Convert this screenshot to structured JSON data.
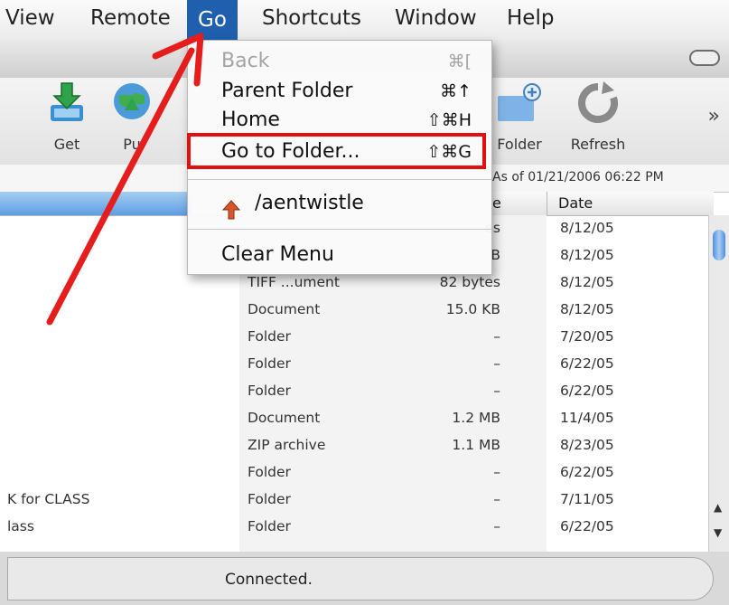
{
  "menubar": {
    "items": [
      "View",
      "Remote",
      "Go",
      "Shortcuts",
      "Window",
      "Help"
    ],
    "active": "Go"
  },
  "toolbar": {
    "buttons": [
      "Get",
      "Pu",
      "Folder",
      "Refresh"
    ],
    "overflow": "»"
  },
  "status_line": "As of 01/21/2006 06:22 PM",
  "columns": {
    "size": "e",
    "date": "Date"
  },
  "rows": [
    {
      "name": "",
      "kind": "",
      "size": "es",
      "date": "8/12/05"
    },
    {
      "name": "",
      "kind": "",
      "size": "B",
      "date": "8/12/05"
    },
    {
      "name": "",
      "kind": "TIFF ...ument",
      "size": "82 bytes",
      "date": "8/12/05"
    },
    {
      "name": "",
      "kind": "Document",
      "size": "15.0 KB",
      "date": "8/12/05"
    },
    {
      "name": "",
      "kind": "Folder",
      "size": "–",
      "date": "7/20/05"
    },
    {
      "name": "",
      "kind": "Folder",
      "size": "–",
      "date": "6/22/05"
    },
    {
      "name": "",
      "kind": "Folder",
      "size": "–",
      "date": "6/22/05"
    },
    {
      "name": "",
      "kind": "Document",
      "size": "1.2 MB",
      "date": "11/4/05"
    },
    {
      "name": "",
      "kind": "ZIP archive",
      "size": "1.1 MB",
      "date": "8/23/05"
    },
    {
      "name": "",
      "kind": "Folder",
      "size": "–",
      "date": "6/22/05"
    },
    {
      "name": "K for CLASS",
      "kind": "Folder",
      "size": "–",
      "date": "7/11/05"
    },
    {
      "name": "lass",
      "kind": "Folder",
      "size": "–",
      "date": "6/22/05"
    }
  ],
  "go_menu": {
    "back": {
      "label": "Back",
      "shortcut": "⌘["
    },
    "parent": {
      "label": "Parent Folder",
      "shortcut": "⌘↑"
    },
    "home": {
      "label": "Home",
      "shortcut": "⇧⌘H"
    },
    "goto": {
      "label": "Go to Folder...",
      "shortcut": "⇧⌘G"
    },
    "recent": {
      "label": "/aentwistle"
    },
    "clear": {
      "label": "Clear Menu"
    }
  },
  "connection": "Connected.",
  "colors": {
    "highlight": "#e30f0f",
    "menu_active": "#1f5fae"
  }
}
